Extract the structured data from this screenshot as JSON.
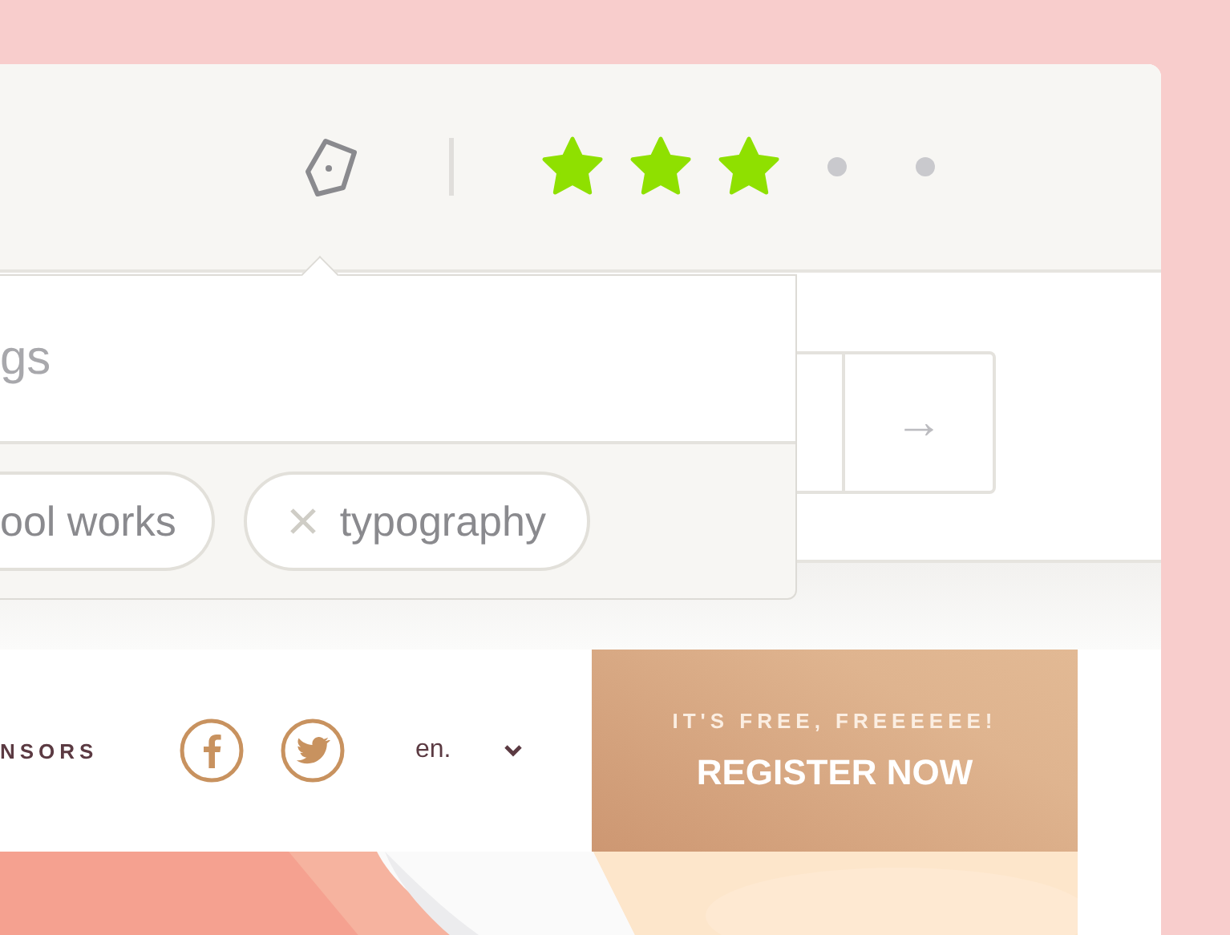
{
  "toolbar": {
    "stars": 3
  },
  "search": {
    "go_button": "→"
  },
  "tag_popover": {
    "search": {
      "placeholder": "gs"
    },
    "tags": [
      {
        "label": "ool works",
        "removable": false
      },
      {
        "label": "typography",
        "removable": true
      }
    ]
  },
  "nav": {
    "link": "NSORS",
    "language": "en."
  },
  "register": {
    "subtitle": "IT'S FREE, FREEEEEE!",
    "title": "REGISTER NOW"
  }
}
